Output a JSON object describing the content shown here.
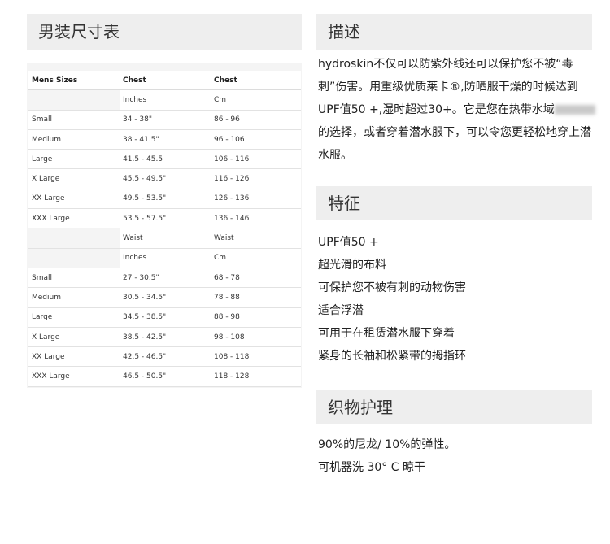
{
  "size_chart": {
    "title": "男装尺寸表",
    "head": [
      "Mens Sizes",
      "Chest",
      "Chest"
    ],
    "rows": [
      [
        "",
        "Inches",
        "Cm"
      ],
      [
        "Small",
        "34 - 38\"",
        "86 - 96"
      ],
      [
        "Medium",
        "38 - 41.5\"",
        "96 - 106"
      ],
      [
        "Large",
        "41.5 - 45.5",
        "106 - 116"
      ],
      [
        "X Large",
        "45.5 - 49.5\"",
        "116 - 126"
      ],
      [
        "XX Large",
        "49.5 - 53.5\"",
        "126 - 136"
      ],
      [
        "XXX Large",
        "53.5 - 57.5\"",
        "136 - 146"
      ],
      [
        "",
        "Waist",
        "Waist"
      ],
      [
        "",
        "Inches",
        "Cm"
      ],
      [
        "Small",
        "27 - 30.5\"",
        "68 - 78"
      ],
      [
        "Medium",
        "30.5 - 34.5\"",
        "78 - 88"
      ],
      [
        "Large",
        "34.5 - 38.5\"",
        "88 - 98"
      ],
      [
        "X Large",
        "38.5 - 42.5\"",
        "98 - 108"
      ],
      [
        "XX Large",
        "42.5 - 46.5\"",
        "108 - 118"
      ],
      [
        "XXX Large",
        "46.5 - 50.5\"",
        "118 - 128"
      ]
    ]
  },
  "description": {
    "title": "描述",
    "text_before": "hydroskin不仅可以防紫外线还可以保护您不被“毒刺”伤害。用重级优质莱卡®,防晒服干燥的时候达到UPF值50 +,湿时超过30+。它是您在热带水域",
    "text_after": "的选择，或者穿着潜水服下，可以令您更轻松地穿上潜水服。"
  },
  "features": {
    "title": "特征",
    "items": [
      "UPF值50 +",
      "超光滑的布料",
      "可保护您不被有刺的动物伤害",
      "适合浮潜",
      "可用于在租赁潜水服下穿着",
      "紧身的长袖和松紧带的拇指环"
    ]
  },
  "care": {
    "title": "织物护理",
    "items": [
      "90%的尼龙/ 10%的弹性。",
      "可机器洗  30° C   晾干"
    ]
  }
}
